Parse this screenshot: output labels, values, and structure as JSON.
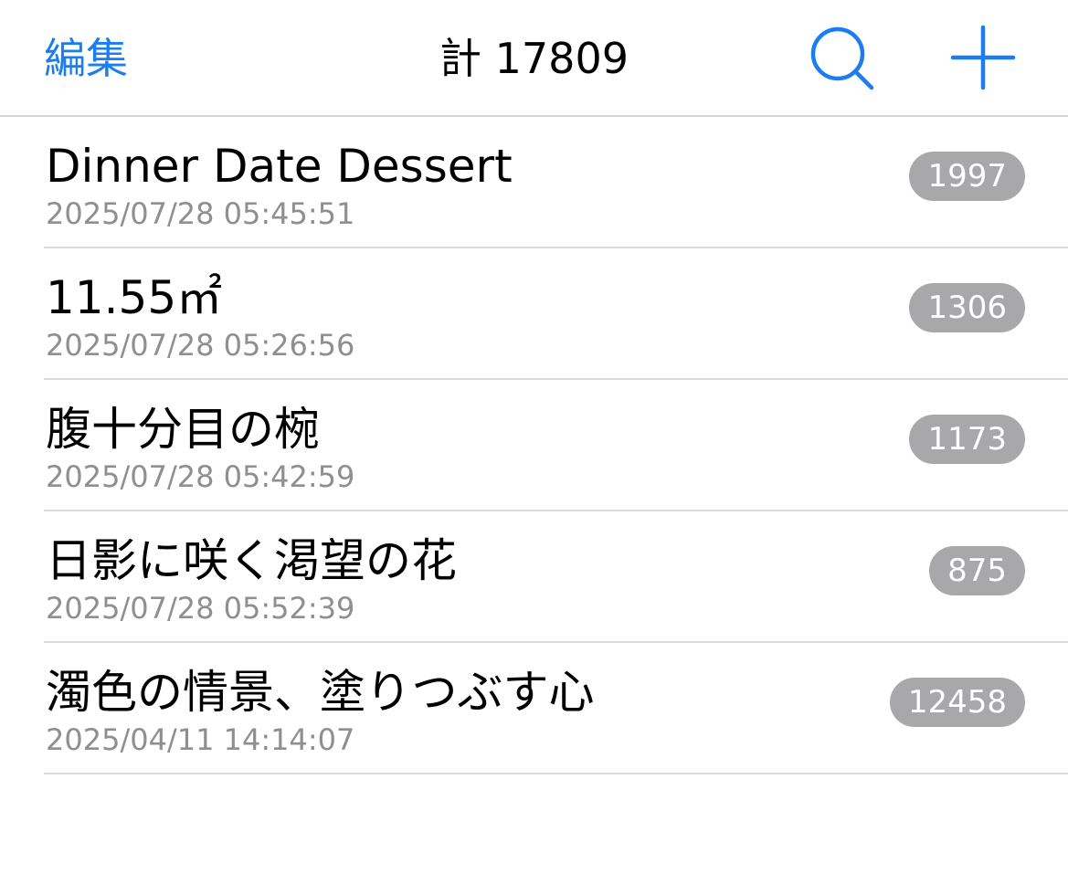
{
  "colors": {
    "accent": "#1a7df0",
    "badge_bg": "#a8a8ab",
    "subtext": "#8e8e93"
  },
  "nav": {
    "edit_label": "編集",
    "title": "計 17809",
    "search_icon": "magnifying-glass",
    "add_icon": "plus"
  },
  "items": [
    {
      "title": "Dinner Date Dessert",
      "date": "2025/07/28 05:45:51",
      "count": "1997"
    },
    {
      "title": "11.55㎡",
      "date": "2025/07/28 05:26:56",
      "count": "1306"
    },
    {
      "title": "腹十分目の椀",
      "date": "2025/07/28 05:42:59",
      "count": "1173"
    },
    {
      "title": "日影に咲く渇望の花",
      "date": "2025/07/28 05:52:39",
      "count": "875"
    },
    {
      "title": "濁色の情景、塗りつぶす心",
      "date": "2025/04/11 14:14:07",
      "count": "12458"
    }
  ]
}
